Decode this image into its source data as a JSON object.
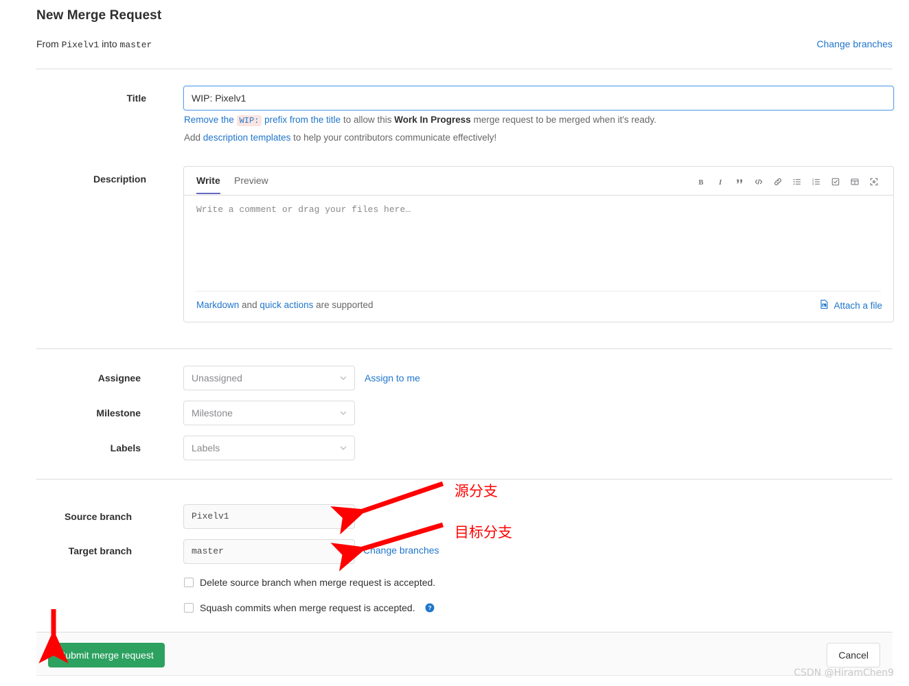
{
  "header": {
    "title": "New Merge Request",
    "from_label": "From",
    "source_branch": "Pixelv1",
    "into_label": "into",
    "target_branch": "master",
    "change_branches_link": "Change branches"
  },
  "title_field": {
    "label": "Title",
    "value": "WIP: Pixelv1",
    "hint1_a": "Remove the",
    "hint1_badge": "WIP:",
    "hint1_b": "prefix from the title",
    "hint1_c": "to allow this",
    "hint1_bold": "Work In Progress",
    "hint1_d": "merge request to be merged when it's ready.",
    "hint2_a": "Add",
    "hint2_link": "description templates",
    "hint2_b": "to help your contributors communicate effectively!"
  },
  "description": {
    "label": "Description",
    "tabs": [
      {
        "label": "Write",
        "active": true
      },
      {
        "label": "Preview",
        "active": false
      }
    ],
    "placeholder": "Write a comment or drag your files here…",
    "toolbar": [
      {
        "name": "bold-icon",
        "title": "Bold"
      },
      {
        "name": "italic-icon",
        "title": "Italic"
      },
      {
        "name": "quote-icon",
        "title": "Insert a quote"
      },
      {
        "name": "code-icon",
        "title": "Insert code"
      },
      {
        "name": "link-icon",
        "title": "Add a link"
      },
      {
        "name": "bulleted-list-icon",
        "title": "Add a bullet list"
      },
      {
        "name": "numbered-list-icon",
        "title": "Add a numbered list"
      },
      {
        "name": "task-list-icon",
        "title": "Add a task list"
      },
      {
        "name": "table-icon",
        "title": "Add a table"
      },
      {
        "name": "fullscreen-icon",
        "title": "Go full screen"
      }
    ],
    "footer_markdown": "Markdown",
    "footer_and": "and",
    "footer_quick_actions": "quick actions",
    "footer_supported": "are supported",
    "attach_label": "Attach a file"
  },
  "meta": {
    "assignee_label": "Assignee",
    "assignee_value": "Unassigned",
    "assign_to_me": "Assign to me",
    "milestone_label": "Milestone",
    "milestone_value": "Milestone",
    "labels_label": "Labels",
    "labels_value": "Labels"
  },
  "branches": {
    "source_label": "Source branch",
    "source_value": "Pixelv1",
    "target_label": "Target branch",
    "target_value": "master",
    "change_branches_link": "Change branches"
  },
  "options": {
    "delete_source": "Delete source branch when merge request is accepted.",
    "squash_commits": "Squash commits when merge request is accepted."
  },
  "footer": {
    "submit_label": "Submit merge request",
    "cancel_label": "Cancel"
  },
  "annotations": {
    "source_note": "源分支",
    "target_note": "目标分支",
    "arrow_color": "#ff0000"
  },
  "watermark": "CSDN @HiramChen9",
  "colors": {
    "link": "#1f75cb",
    "submit_green": "#2da160",
    "focus_border": "#63a6e9",
    "annotation_red": "#ff0000"
  }
}
